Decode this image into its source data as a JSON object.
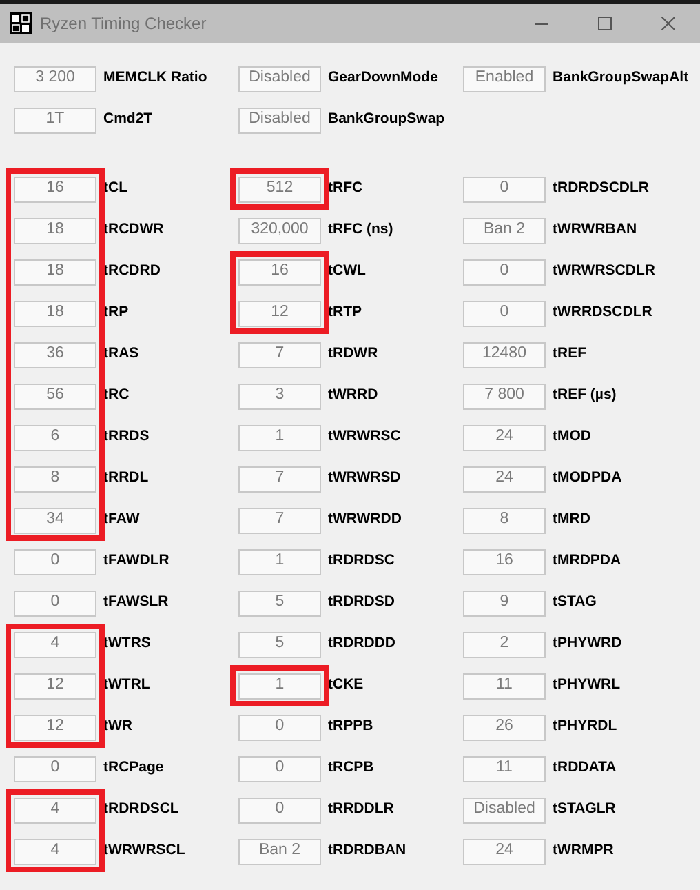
{
  "window": {
    "title": "Ryzen Timing Checker"
  },
  "settings": [
    [
      {
        "value": "3 200",
        "label": "MEMCLK Ratio"
      },
      {
        "value": "Disabled",
        "label": "GearDownMode"
      },
      {
        "value": "Enabled",
        "label": "BankGroupSwapAlt"
      }
    ],
    [
      {
        "value": "1T",
        "label": "Cmd2T"
      },
      {
        "value": "Disabled",
        "label": "BankGroupSwap"
      }
    ]
  ],
  "timings": [
    {
      "rows": [
        {
          "value": "16",
          "label": "tCL",
          "highlighted": true
        },
        {
          "value": "18",
          "label": "tRCDWR",
          "highlighted": true
        },
        {
          "value": "18",
          "label": "tRCDRD",
          "highlighted": true
        },
        {
          "value": "18",
          "label": "tRP",
          "highlighted": true
        },
        {
          "value": "36",
          "label": "tRAS",
          "highlighted": true
        },
        {
          "value": "56",
          "label": "tRC",
          "highlighted": true
        },
        {
          "value": "6",
          "label": "tRRDS",
          "highlighted": true
        },
        {
          "value": "8",
          "label": "tRRDL",
          "highlighted": true
        },
        {
          "value": "34",
          "label": "tFAW",
          "highlighted": true
        },
        {
          "value": "0",
          "label": "tFAWDLR",
          "highlighted": false
        },
        {
          "value": "0",
          "label": "tFAWSLR",
          "highlighted": false
        },
        {
          "value": "4",
          "label": "tWTRS",
          "highlighted": true
        },
        {
          "value": "12",
          "label": "tWTRL",
          "highlighted": true
        },
        {
          "value": "12",
          "label": "tWR",
          "highlighted": true
        },
        {
          "value": "0",
          "label": "tRCPage",
          "highlighted": false
        },
        {
          "value": "4",
          "label": "tRDRDSCL",
          "highlighted": true
        },
        {
          "value": "4",
          "label": "tWRWRSCL",
          "highlighted": true
        }
      ]
    },
    {
      "rows": [
        {
          "value": "512",
          "label": "tRFC",
          "highlighted": true
        },
        {
          "value": "320,000",
          "label": "tRFC (ns)",
          "highlighted": false
        },
        {
          "value": "16",
          "label": "tCWL",
          "highlighted": true
        },
        {
          "value": "12",
          "label": "tRTP",
          "highlighted": true
        },
        {
          "value": "7",
          "label": "tRDWR",
          "highlighted": false
        },
        {
          "value": "3",
          "label": "tWRRD",
          "highlighted": false
        },
        {
          "value": "1",
          "label": "tWRWRSC",
          "highlighted": false
        },
        {
          "value": "7",
          "label": "tWRWRSD",
          "highlighted": false
        },
        {
          "value": "7",
          "label": "tWRWRDD",
          "highlighted": false
        },
        {
          "value": "1",
          "label": "tRDRDSC",
          "highlighted": false
        },
        {
          "value": "5",
          "label": "tRDRDSD",
          "highlighted": false
        },
        {
          "value": "5",
          "label": "tRDRDDD",
          "highlighted": false
        },
        {
          "value": "1",
          "label": "tCKE",
          "highlighted": true
        },
        {
          "value": "0",
          "label": "tRPPB",
          "highlighted": false
        },
        {
          "value": "0",
          "label": "tRCPB",
          "highlighted": false
        },
        {
          "value": "0",
          "label": "tRRDDLR",
          "highlighted": false
        },
        {
          "value": "Ban 2",
          "label": "tRDRDBAN",
          "highlighted": false
        }
      ]
    },
    {
      "rows": [
        {
          "value": "0",
          "label": "tRDRDSCDLR",
          "highlighted": false
        },
        {
          "value": "Ban 2",
          "label": "tWRWRBAN",
          "highlighted": false
        },
        {
          "value": "0",
          "label": "tWRWRSCDLR",
          "highlighted": false
        },
        {
          "value": "0",
          "label": "tWRRDSCDLR",
          "highlighted": false
        },
        {
          "value": "12480",
          "label": "tREF",
          "highlighted": false
        },
        {
          "value": "7 800",
          "label": "tREF (µs)",
          "highlighted": false
        },
        {
          "value": "24",
          "label": "tMOD",
          "highlighted": false
        },
        {
          "value": "24",
          "label": "tMODPDA",
          "highlighted": false
        },
        {
          "value": "8",
          "label": "tMRD",
          "highlighted": false
        },
        {
          "value": "16",
          "label": "tMRDPDA",
          "highlighted": false
        },
        {
          "value": "9",
          "label": "tSTAG",
          "highlighted": false
        },
        {
          "value": "2",
          "label": "tPHYWRD",
          "highlighted": false
        },
        {
          "value": "11",
          "label": "tPHYWRL",
          "highlighted": false
        },
        {
          "value": "26",
          "label": "tPHYRDL",
          "highlighted": false
        },
        {
          "value": "11",
          "label": "tRDDATA",
          "highlighted": false
        },
        {
          "value": "Disabled",
          "label": "tSTAGLR",
          "highlighted": false
        },
        {
          "value": "24",
          "label": "tWRMPR",
          "highlighted": false
        }
      ]
    }
  ]
}
